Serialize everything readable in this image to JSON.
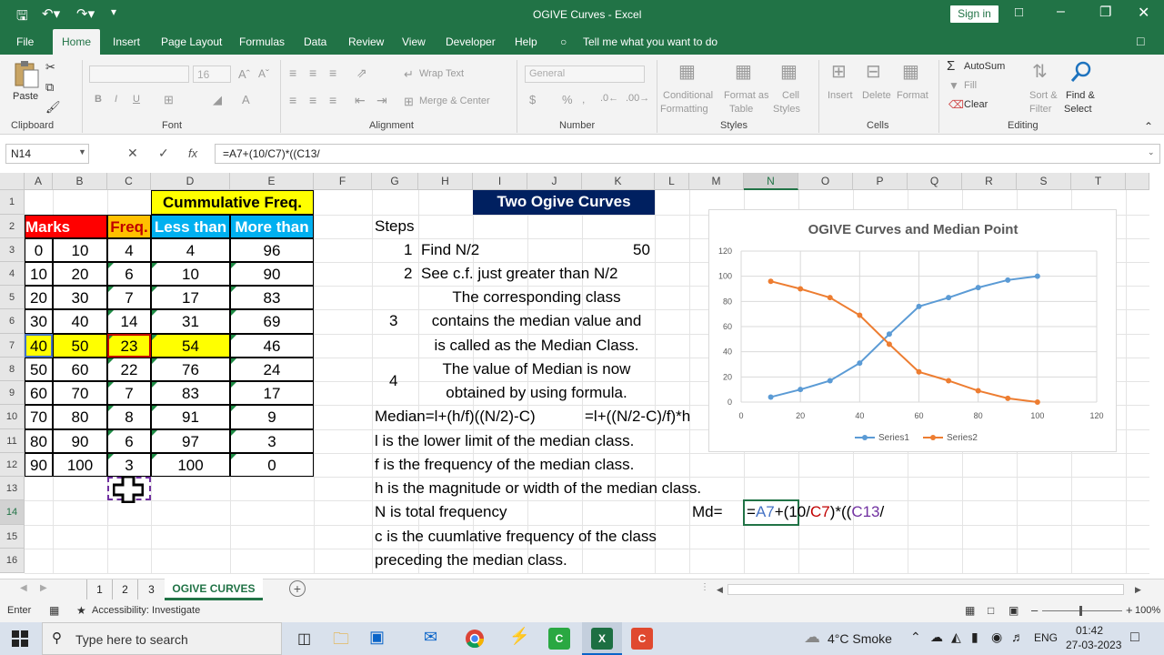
{
  "window": {
    "title": "OGIVE Curves  -  Excel",
    "signin": "Sign in"
  },
  "menu": {
    "file": "File",
    "home": "Home",
    "insert": "Insert",
    "page_layout": "Page Layout",
    "formulas": "Formulas",
    "data": "Data",
    "review": "Review",
    "view": "View",
    "developer": "Developer",
    "help": "Help",
    "tell": "Tell me what you want to do"
  },
  "ribbon": {
    "clipboard": {
      "paste": "Paste",
      "group": "Clipboard"
    },
    "font": {
      "name": "",
      "size": "16",
      "group": "Font",
      "b": "B",
      "i": "I",
      "u": "U"
    },
    "alignment": {
      "wrap": "Wrap Text",
      "merge": "Merge & Center",
      "group": "Alignment"
    },
    "number": {
      "format": "General",
      "group": "Number",
      "dollar": "$",
      "percent": "%"
    },
    "styles": {
      "conditional1": "Conditional",
      "conditional2": "Formatting",
      "format_as1": "Format as",
      "format_as2": "Table",
      "cell_styles1": "Cell",
      "cell_styles2": "Styles",
      "group": "Styles"
    },
    "cells": {
      "insert": "Insert",
      "delete": "Delete",
      "format": "Format",
      "group": "Cells"
    },
    "editing": {
      "autosum": "AutoSum",
      "fill": "Fill",
      "clear": "Clear",
      "sort1": "Sort &",
      "sort2": "Filter",
      "find1": "Find &",
      "find2": "Select",
      "group": "Editing"
    }
  },
  "formula_bar": {
    "name_box": "N14",
    "fx": "fx",
    "formula": "=A7+(10/C7)*((C13/"
  },
  "columns": [
    "A",
    "B",
    "C",
    "D",
    "F",
    "G",
    "H",
    "I",
    "J",
    "K",
    "L",
    "M",
    "N",
    "O",
    "P",
    "Q",
    "R",
    "S",
    "T",
    "E"
  ],
  "rows": [
    "1",
    "2",
    "3",
    "4",
    "5",
    "6",
    "7",
    "8",
    "9",
    "10",
    "11",
    "12",
    "13",
    "14",
    "15",
    "16"
  ],
  "table": {
    "cum_header": "Cummulative Freq.",
    "headers": [
      "Marks",
      "Freq.",
      "Less than",
      "More than"
    ],
    "rows": [
      [
        "0",
        "10",
        "4",
        "4",
        "96"
      ],
      [
        "10",
        "20",
        "6",
        "10",
        "90"
      ],
      [
        "20",
        "30",
        "7",
        "17",
        "83"
      ],
      [
        "30",
        "40",
        "14",
        "31",
        "69"
      ],
      [
        "40",
        "50",
        "23",
        "54",
        "46"
      ],
      [
        "50",
        "60",
        "22",
        "76",
        "24"
      ],
      [
        "60",
        "70",
        "7",
        "83",
        "17"
      ],
      [
        "70",
        "80",
        "8",
        "91",
        "9"
      ],
      [
        "80",
        "90",
        "6",
        "97",
        "3"
      ],
      [
        "90",
        "100",
        "3",
        "100",
        "0"
      ]
    ]
  },
  "notes": {
    "title": "Two Ogive Curves",
    "steps": "Steps",
    "s1n": "1",
    "s1": "Find N/2",
    "s1v": "50",
    "s2n": "2",
    "s2": "See c.f. just greater than N/2",
    "s3n": "3",
    "s3a": "The corresponding class",
    "s3b": "contains the median value and",
    "s3c": "is called as the Median Class.",
    "s4n": "4",
    "s4a": "The value of Median is now",
    "s4b": "obtained by using formula.",
    "formula1": "Median=l+(h/f)((N/2)-C)",
    "formula2": "=l+((N/2-C)/f)*h",
    "l1": "l is the lower limit of the median class.",
    "l2": "f is the frequency of the median class.",
    "l3": "h is the magnitude or width of the median class.",
    "l4": "N is total frequency",
    "l5": "c is the cuumlative frequency of the class",
    "l6": "preceding the median class.",
    "md": "Md=",
    "edit": {
      "p1": "=",
      "p2": "A7",
      "p3": "+(10/",
      "p4": "C7",
      "p5": ")*((",
      "p6": "C13",
      "p7": "/"
    }
  },
  "chart_data": {
    "type": "line",
    "title": "OGIVE Curves and Median Point",
    "xlim": [
      0,
      120
    ],
    "ylim": [
      0,
      120
    ],
    "xticks": [
      "0",
      "20",
      "40",
      "60",
      "80",
      "100",
      "120"
    ],
    "yticks": [
      "0",
      "20",
      "40",
      "60",
      "80",
      "100",
      "120"
    ],
    "series": [
      {
        "name": "Series1",
        "color": "#5b9bd5",
        "x": [
          10,
          20,
          30,
          40,
          50,
          60,
          70,
          80,
          90,
          100
        ],
        "y": [
          4,
          10,
          17,
          31,
          54,
          76,
          83,
          91,
          97,
          100
        ]
      },
      {
        "name": "Series2",
        "color": "#ed7d31",
        "x": [
          10,
          20,
          30,
          40,
          50,
          60,
          70,
          80,
          90,
          100
        ],
        "y": [
          96,
          90,
          83,
          69,
          46,
          24,
          17,
          9,
          3,
          0
        ]
      }
    ],
    "legend": "bottom",
    "grid": true
  },
  "sheets": {
    "t1": "1",
    "t2": "2",
    "t3": "3",
    "t4": "OGIVE CURVES",
    "add": "+"
  },
  "status": {
    "mode": "Enter",
    "accessibility": "Accessibility: Investigate",
    "zoom": "100%"
  },
  "taskbar": {
    "search": "Type here to search",
    "weather": "4°C  Smoke",
    "lang": "ENG",
    "time": "01:42",
    "date": "27-03-2023"
  }
}
